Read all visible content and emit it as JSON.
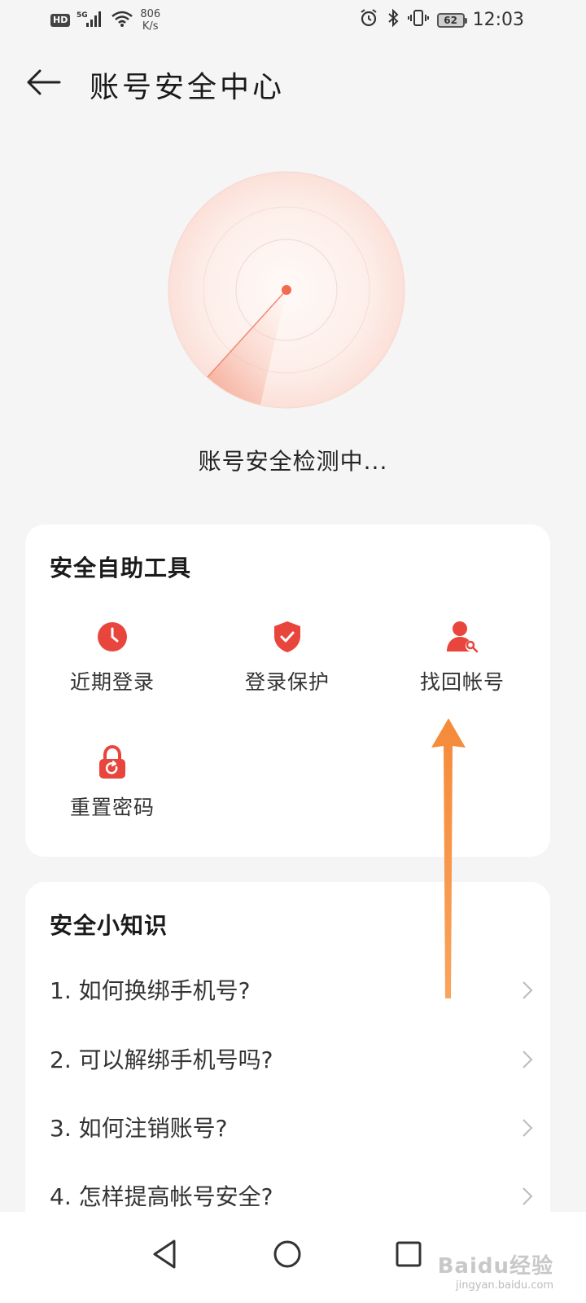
{
  "status_bar": {
    "hd": "HD",
    "signal": "5G",
    "net_speed_value": "806",
    "net_speed_unit": "K/s",
    "battery": "62",
    "time": "12:03"
  },
  "header": {
    "title": "账号安全中心"
  },
  "scan": {
    "status_text": "账号安全检测中..."
  },
  "tools": {
    "title": "安全自助工具",
    "items": [
      {
        "label": "近期登录",
        "icon": "clock-icon"
      },
      {
        "label": "登录保护",
        "icon": "shield-check-icon"
      },
      {
        "label": "找回帐号",
        "icon": "user-search-icon"
      },
      {
        "label": "重置密码",
        "icon": "lock-reset-icon"
      }
    ]
  },
  "tips": {
    "title": "安全小知识",
    "items": [
      {
        "label": "1. 如何换绑手机号?"
      },
      {
        "label": "2. 可以解绑手机号吗?"
      },
      {
        "label": "3. 如何注销账号?"
      },
      {
        "label": "4. 怎样提高帐号安全?"
      }
    ]
  },
  "watermark": {
    "logo": "Baidu经验",
    "url": "jingyan.baidu.com"
  },
  "colors": {
    "accent": "#e8453c",
    "arrow": "#f7913d",
    "radar": "#f26b50"
  }
}
